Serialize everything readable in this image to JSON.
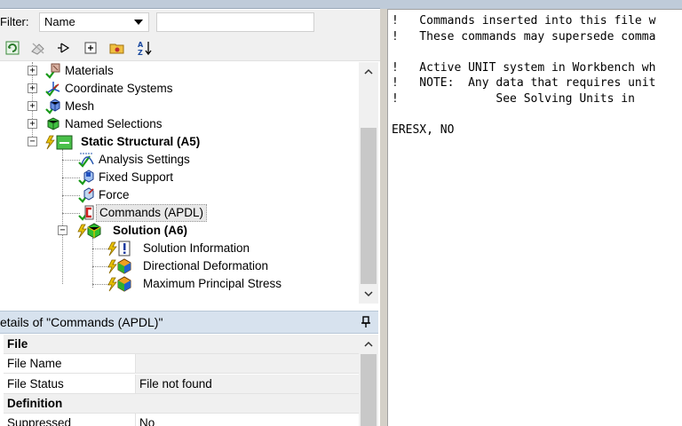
{
  "filter": {
    "label": "Filter:",
    "selected": "Name"
  },
  "tree": {
    "items": [
      {
        "label": "Materials"
      },
      {
        "label": "Coordinate Systems"
      },
      {
        "label": "Mesh"
      },
      {
        "label": "Named Selections"
      },
      {
        "label": "Static Structural (A5)"
      },
      {
        "label": "Analysis Settings"
      },
      {
        "label": "Fixed Support"
      },
      {
        "label": "Force"
      },
      {
        "label": "Commands (APDL)"
      },
      {
        "label": "Solution (A6)"
      },
      {
        "label": "Solution Information"
      },
      {
        "label": "Directional Deformation"
      },
      {
        "label": "Maximum Principal Stress"
      }
    ]
  },
  "details": {
    "title": "etails of \"Commands (APDL)\"",
    "rows": [
      {
        "key": "File",
        "value": ""
      },
      {
        "key": "File Name",
        "value": ""
      },
      {
        "key": "File Status",
        "value": "File not found"
      },
      {
        "key": "Definition",
        "value": ""
      },
      {
        "key": "Suppressed",
        "value": "No"
      }
    ]
  },
  "editor": {
    "lines": [
      "!   Commands inserted into this file w",
      "!   These commands may supersede comma",
      "",
      "!   Active UNIT system in Workbench wh",
      "!   NOTE:  Any data that requires unit",
      "!              See Solving Units in",
      "",
      "ERESX, NO"
    ]
  },
  "colors": {
    "check": "#1a9a1a",
    "lightning": "#e8c000",
    "header_bg": "#d7e2ee"
  }
}
